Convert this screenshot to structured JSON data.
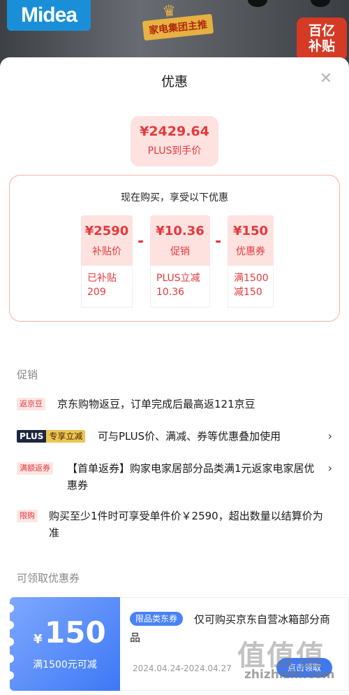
{
  "banner": {
    "brand": "Midea",
    "ribbon": "家电集团主推",
    "subsidy_badge_line1": "百亿",
    "subsidy_badge_line2": "补贴"
  },
  "sheet": {
    "title": "优惠",
    "close_icon": "close-icon"
  },
  "final_price": {
    "amount": "¥2429.64",
    "label": "PLUS到手价"
  },
  "breakdown": {
    "heading": "现在购买，享受以下优惠",
    "minus": "-",
    "items": [
      {
        "value": "¥2590",
        "caption": "补贴价",
        "detail_line1": "已补贴",
        "detail_line2": "209"
      },
      {
        "value": "¥10.36",
        "caption": "促销",
        "detail_line1": "PLUS立减",
        "detail_line2": "10.36"
      },
      {
        "value": "¥150",
        "caption": "优惠券",
        "detail_line1": "满1500",
        "detail_line2": "减150"
      }
    ]
  },
  "promotions": {
    "title": "促销",
    "items": [
      {
        "tag": "返京豆",
        "text": "京东购物返豆，订单完成后最高返121京豆"
      },
      {
        "tag_part1": "PLUS",
        "tag_part2": "专享立减",
        "text": "可与PLUS价、满减、券等优惠叠加使用",
        "chevron": "›"
      },
      {
        "tag": "满额返券",
        "text": "【首单返券】购家电家居部分品类满1元返家电家居优惠券",
        "chevron": "›"
      },
      {
        "tag": "限购",
        "text": "购买至少1件时可享受单件价￥2590，超出数量以结算价为准"
      }
    ]
  },
  "coupons": {
    "title": "可领取优惠券",
    "items": [
      {
        "currency": "¥",
        "amount": "150",
        "condition": "满1500元可减",
        "tag": "限品类东券",
        "description": "仅可购买京东自营冰箱部分商品",
        "date_range": "2024.04.24-2024.04.27",
        "button": "点击领取"
      }
    ]
  },
  "watermark": {
    "text": "值值值",
    "url": "zhizhizhi.com"
  },
  "colors": {
    "accent_red": "#e4393c",
    "light_red_bg": "#fde2e0",
    "coupon_blue": "#3d78f5",
    "plus_dark": "#1c2740",
    "plus_gold": "#f0c453"
  }
}
